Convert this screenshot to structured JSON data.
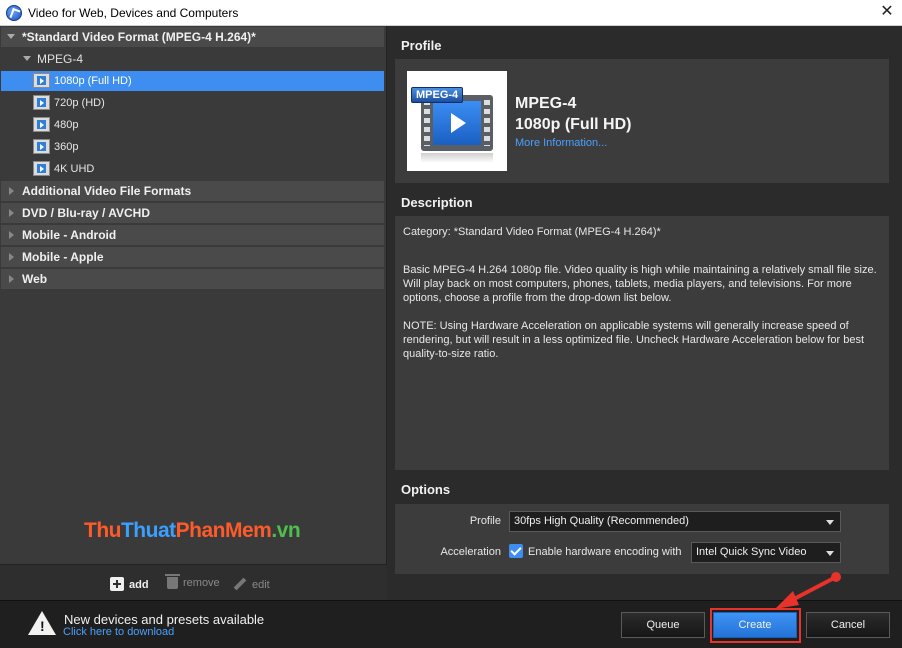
{
  "window": {
    "title": "Video for Web, Devices and Computers",
    "close_glyph": "✕"
  },
  "tree": {
    "root_category": "*Standard Video Format (MPEG-4 H.264)*",
    "subcategory": "MPEG-4",
    "items": [
      {
        "label": "1080p (Full HD)",
        "selected": true
      },
      {
        "label": "720p (HD)",
        "selected": false
      },
      {
        "label": "480p",
        "selected": false
      },
      {
        "label": "360p",
        "selected": false
      },
      {
        "label": "4K UHD",
        "selected": false
      }
    ],
    "categories": [
      "Additional Video File Formats",
      "DVD / Blu-ray / AVCHD",
      "Mobile - Android",
      "Mobile - Apple",
      "Web"
    ]
  },
  "watermark": {
    "part1": "Thu",
    "part2": "Thuat",
    "part3": "PhanMem",
    "part4": ".vn"
  },
  "left_toolbar": {
    "add": "add",
    "remove": "remove",
    "edit": "edit"
  },
  "profile": {
    "section_title": "Profile",
    "badge": "MPEG-4",
    "name": "MPEG-4",
    "resolution": "1080p (Full HD)",
    "more_info": "More Information..."
  },
  "description": {
    "section_title": "Description",
    "category": "Category: *Standard Video Format (MPEG-4 H.264)*",
    "body": "Basic MPEG-4 H.264 1080p file. Video quality is high while maintaining a relatively small file size. Will play back on most computers, phones, tablets, media players, and televisions. For more options, choose a profile from the drop-down list below.",
    "note": "NOTE: Using Hardware Acceleration on applicable systems will generally increase speed of rendering, but will result in a less optimized file. Uncheck Hardware Acceleration below for best quality-to-size ratio."
  },
  "options": {
    "section_title": "Options",
    "profile_label": "Profile",
    "profile_value": "30fps High Quality (Recommended)",
    "acceleration_label": "Acceleration",
    "hw_encoding_label": "Enable hardware encoding with",
    "hw_encoding_checked": true,
    "encoder_value": "Intel Quick Sync Video"
  },
  "footer": {
    "notice_title": "New devices and presets available",
    "notice_link": "Click here to download",
    "queue": "Queue",
    "create": "Create",
    "cancel": "Cancel"
  },
  "colors": {
    "accent": "#3d8ef0",
    "annotation": "#e8322c"
  }
}
